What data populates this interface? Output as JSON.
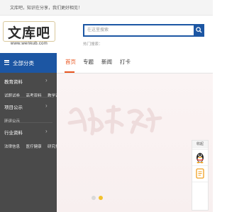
{
  "topbar": {
    "text": "文库吧，知识在分享，我们更好相见！"
  },
  "logo": {
    "name": "文库吧",
    "url": "www.wenkub.com"
  },
  "search": {
    "placeholder": "在这里搜索"
  },
  "hot_label": "热门搜索：",
  "categories": {
    "title": "全部分类",
    "groups": [
      {
        "title": "教育资料",
        "links": [
          "试题试卷",
          "高考资料",
          "教学课件"
        ]
      },
      {
        "title": "项目公示",
        "links": [
          "环评公示"
        ]
      },
      {
        "title": "行业资料",
        "links": [
          "法律信息",
          "医疗健康",
          "研究报告"
        ]
      }
    ]
  },
  "nav": {
    "tabs": [
      "首页",
      "专题",
      "新闻",
      "打卡"
    ],
    "active_index": 0
  },
  "carousel": {
    "slide_count": 2,
    "active_index": 1
  },
  "float": {
    "title": "收起"
  },
  "colors": {
    "brand": "#1c56a3",
    "accent": "#e8541e",
    "sidebar": "#4a4a4a",
    "dot_active": "#f2c12e"
  }
}
